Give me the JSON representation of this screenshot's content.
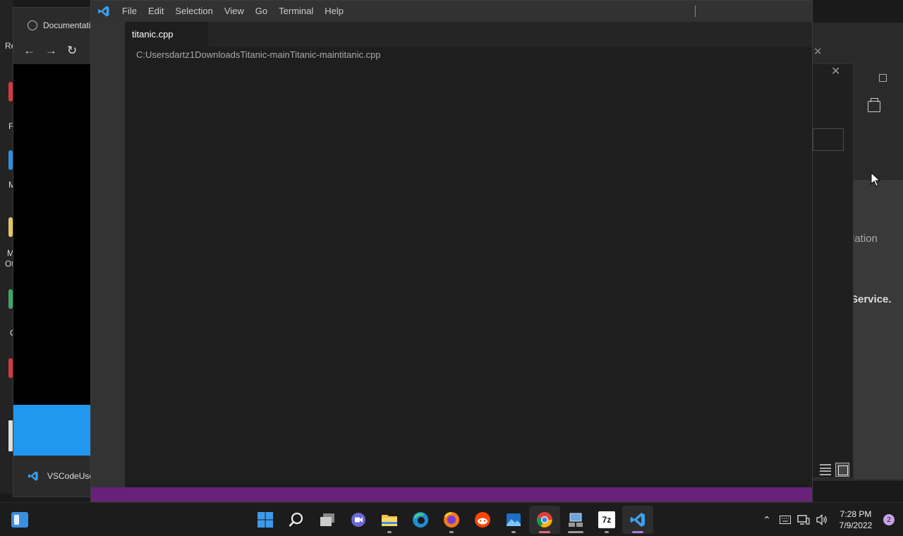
{
  "desktop": {
    "fragments": [
      "Re",
      "F",
      "M",
      "M",
      "Ot",
      "C"
    ]
  },
  "browser": {
    "tab_title": "Documentati",
    "status_label": "VSCodeUse"
  },
  "right_windows": {
    "text_1": "lation",
    "text_2": "Service."
  },
  "vscode": {
    "menu": [
      "File",
      "Edit",
      "Selection",
      "View",
      "Go",
      "Terminal",
      "Help"
    ],
    "tab_label": "titanic.cpp",
    "breadcrumb": "C:Usersdartz1DownloadsTitanic-mainTitanic-maintitanic.cpp",
    "status_color": "#68217a",
    "accent_color": "#007acc"
  },
  "taskbar": {
    "apps": [
      "widgets-icon",
      "start-icon",
      "search-icon",
      "task-view-icon",
      "chat-icon",
      "file-explorer-icon",
      "edge-icon",
      "firefox-icon",
      "reddit-icon",
      "photos-icon",
      "chrome-icon",
      "network-app-icon",
      "7zip-icon",
      "vscode-icon"
    ],
    "time": "7:28 PM",
    "date": "7/9/2022",
    "notification_count": "2",
    "seven_zip_label": "7z"
  }
}
